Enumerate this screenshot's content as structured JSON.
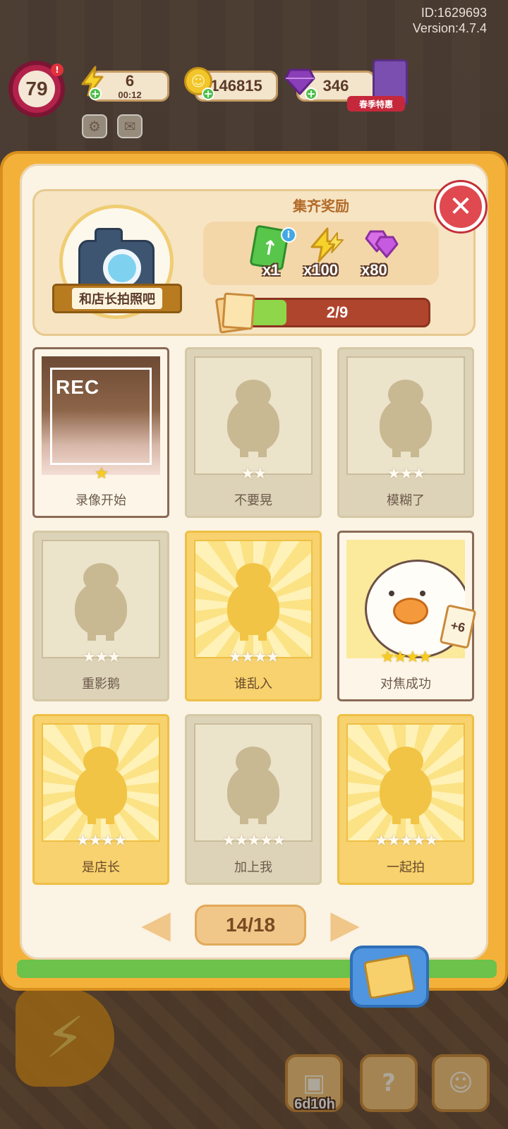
{
  "meta": {
    "id_text": "ID:1629693",
    "version_text": "Version:4.7.4"
  },
  "hud": {
    "level": "79",
    "energy": {
      "value": "6",
      "timer": "00:12",
      "icon": "bolt-icon"
    },
    "coins": {
      "value": "146815",
      "icon": "coin-icon"
    },
    "gems": {
      "value": "346",
      "icon": "gem-icon"
    },
    "shop_label": "春季特惠"
  },
  "album": {
    "theme_label": "和店长拍照吧",
    "reward_title": "集齐奖励",
    "rewards": [
      {
        "icon": "upgrade-card-icon",
        "qty": "x1"
      },
      {
        "icon": "bolt-icon",
        "qty": "x100"
      },
      {
        "icon": "gem-icon",
        "qty": "x80"
      }
    ],
    "progress": {
      "text": "2/9",
      "value": 0.2222
    },
    "cards": [
      {
        "label": "录像开始",
        "stars": 1,
        "filled": 1,
        "state": "unlocked",
        "photo_text": "REC"
      },
      {
        "label": "不要晃",
        "stars": 2,
        "filled": 0,
        "state": "locked"
      },
      {
        "label": "模糊了",
        "stars": 3,
        "filled": 0,
        "state": "locked"
      },
      {
        "label": "重影鹅",
        "stars": 3,
        "filled": 0,
        "state": "locked"
      },
      {
        "label": "谁乱入",
        "stars": 4,
        "filled": 0,
        "state": "gold"
      },
      {
        "label": "对焦成功",
        "stars": 4,
        "filled": 4,
        "state": "unlocked",
        "duplicate_badge": "+6"
      },
      {
        "label": "是店长",
        "stars": 4,
        "filled": 0,
        "state": "gold"
      },
      {
        "label": "加上我",
        "stars": 5,
        "filled": 0,
        "state": "locked"
      },
      {
        "label": "一起拍",
        "stars": 5,
        "filled": 0,
        "state": "gold"
      }
    ],
    "pagination": {
      "text": "14/18"
    }
  },
  "bottom": {
    "event_timer": "6d10h"
  },
  "colors": {
    "panel_orange": "#f4b13a",
    "panel_cream": "#fbf3e3",
    "close_red": "#e0494f",
    "progress_red": "#b0452e",
    "progress_green": "#8fd64a",
    "star_gold": "#f7cc1e"
  }
}
